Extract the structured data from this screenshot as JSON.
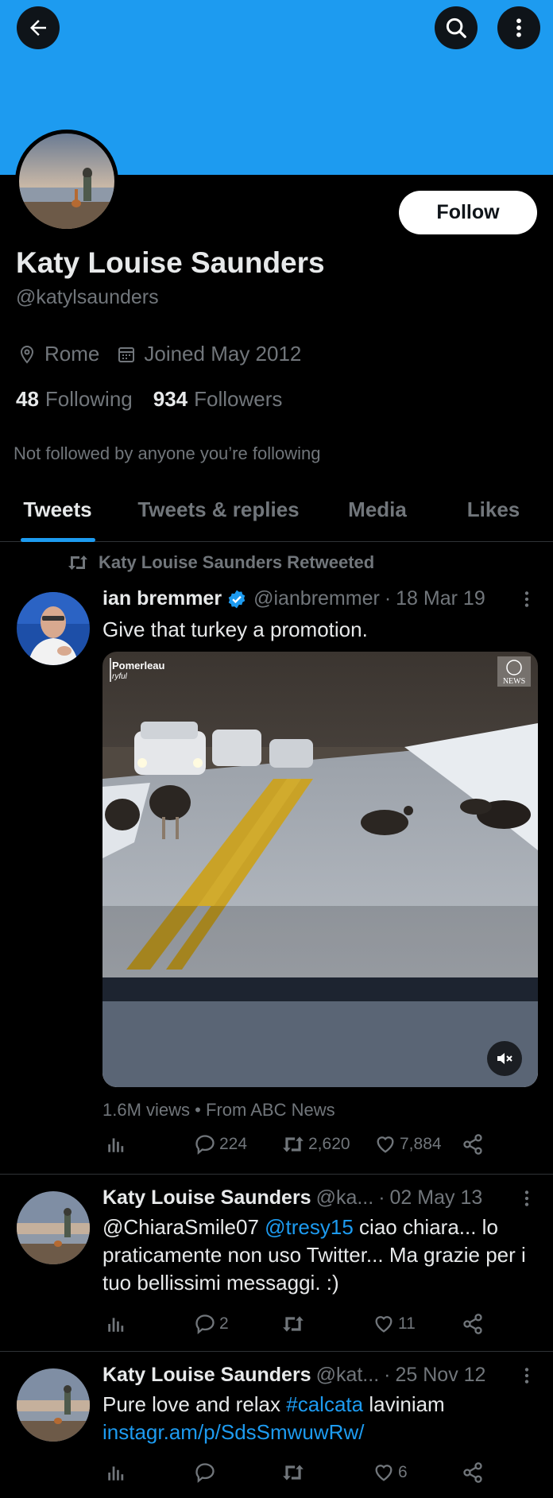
{
  "profile": {
    "name": "Katy Louise Saunders",
    "handle": "@katylsaunders",
    "location": "Rome",
    "joined": "Joined May 2012",
    "following_count": "48",
    "following_label": "Following",
    "followers_count": "934",
    "followers_label": "Followers",
    "follow_button": "Follow",
    "not_followed_note": "Not followed by anyone you’re following"
  },
  "tabs": [
    {
      "label": "Tweets",
      "active": true
    },
    {
      "label": "Tweets & replies",
      "active": false
    },
    {
      "label": "Media",
      "active": false
    },
    {
      "label": "Likes",
      "active": false
    }
  ],
  "tweets": [
    {
      "retweeted_by": "Katy Louise Saunders Retweeted",
      "author": "ian bremmer",
      "verified": true,
      "handle": "@ianbremmer",
      "date": "18 Mar 19",
      "text": "Give that turkey a promotion.",
      "media_watermark_left": "Pomerleau",
      "media_watermark_left_sub": "ryful",
      "media_watermark_right": "NEWS",
      "views": "1.6M views",
      "source": "From ABC News",
      "replies": "224",
      "retweets": "2,620",
      "likes": "7,884"
    },
    {
      "author": "Katy Louise Saunders",
      "handle": "@ka...",
      "date": "02 May 13",
      "text_mention1": "@ChiaraSmile07",
      "text_mention2": "@tresy15",
      "text_rest": "ciao chiara... lo praticamente non uso Twitter... Ma grazie per i tuo bellissimi messaggi. :)",
      "replies": "2",
      "retweets": "",
      "likes": "11"
    },
    {
      "author": "Katy Louise Saunders",
      "handle": "@kat...",
      "date": "25 Nov 12",
      "text_a": "Pure love and relax",
      "text_hashtag": "#calcata",
      "text_b": "laviniam",
      "text_link": "instagr.am/p/SdsSmwuwRw/",
      "replies": "",
      "retweets": "",
      "likes": "6"
    }
  ],
  "colors": {
    "accent": "#1d9bf0",
    "background": "#000000",
    "text": "#e7e9ea",
    "muted": "#71767b"
  },
  "icons": [
    "back-arrow-icon",
    "search-icon",
    "more-vertical-icon",
    "location-pin-icon",
    "calendar-icon",
    "retweet-icon",
    "verified-badge-icon",
    "analytics-icon",
    "reply-icon",
    "like-icon",
    "share-icon",
    "mute-icon"
  ]
}
